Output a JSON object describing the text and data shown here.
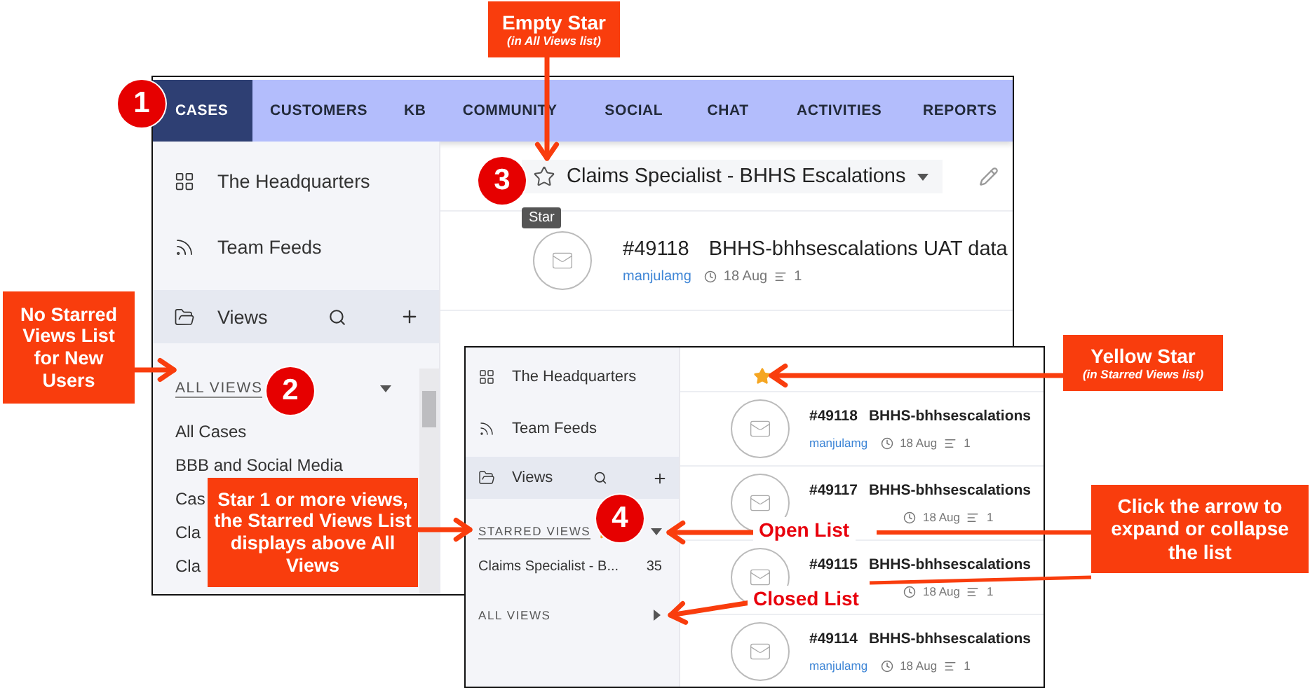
{
  "main_screenshot": {
    "nav_tabs": [
      {
        "label": "CASES",
        "selected": true
      },
      {
        "label": "CUSTOMERS",
        "selected": false
      },
      {
        "label": "KB",
        "selected": false
      },
      {
        "label": "COMMUNITY",
        "selected": false
      },
      {
        "label": "SOCIAL",
        "selected": false
      },
      {
        "label": "CHAT",
        "selected": false
      },
      {
        "label": "ACTIVITIES",
        "selected": false
      },
      {
        "label": "REPORTS",
        "selected": false
      }
    ],
    "sidebar": {
      "items": [
        "The Headquarters",
        "Team Feeds"
      ],
      "views_label": "Views",
      "all_views": {
        "label": "ALL VIEWS",
        "expanded": true,
        "items": [
          "All Cases",
          "BBB and Social Media",
          "Cas",
          "Cla",
          "Cla"
        ]
      }
    },
    "view_header": {
      "title": "Claims Specialist - BHHS Escalations",
      "starred": false
    },
    "tooltip": "Star",
    "cases": [
      {
        "number": "#49118",
        "subject": "BHHS-bhhsescalations UAT data",
        "author": "manjulamg",
        "date": "18 Aug",
        "replies": "1"
      }
    ]
  },
  "starred_screenshot": {
    "sidebar": {
      "items": [
        "The Headquarters",
        "Team Feeds"
      ],
      "views_label": "Views",
      "starred_views": {
        "label": "STARRED VIEWS",
        "expanded": true,
        "items": [
          {
            "name": "Claims Specialist - B...",
            "count": "35"
          }
        ]
      },
      "all_views": {
        "label": "ALL VIEWS",
        "expanded": false
      }
    },
    "view_header": {
      "starred": true
    },
    "cases": [
      {
        "number": "#49118",
        "subject": "BHHS-bhhsescalations",
        "author": "manjulamg",
        "date": "18 Aug",
        "replies": "1"
      },
      {
        "number": "#49117",
        "subject": "BHHS-bhhsescalations",
        "date": "18 Aug",
        "replies": "1"
      },
      {
        "number": "#49115",
        "subject": "BHHS-bhhsescalations",
        "date": "18 Aug",
        "replies": "1"
      },
      {
        "number": "#49114",
        "subject": "BHHS-bhhsescalations",
        "author": "manjulamg",
        "date": "18 Aug",
        "replies": "1"
      }
    ]
  },
  "callouts": [
    {
      "title": "Empty Star",
      "note": "(in All Views list)"
    },
    {
      "title": "No Starred Views List for New Users"
    },
    {
      "title": "Star 1 or more views, the Starred Views List displays above All Views"
    },
    {
      "title": "Yellow Star",
      "note": "(in Starred Views list)"
    },
    {
      "title": "Click the arrow to expand or collapse the list"
    }
  ],
  "step_markers": [
    "1",
    "2",
    "3",
    "4"
  ],
  "arrow_labels": [
    "Open List",
    "Closed List"
  ]
}
